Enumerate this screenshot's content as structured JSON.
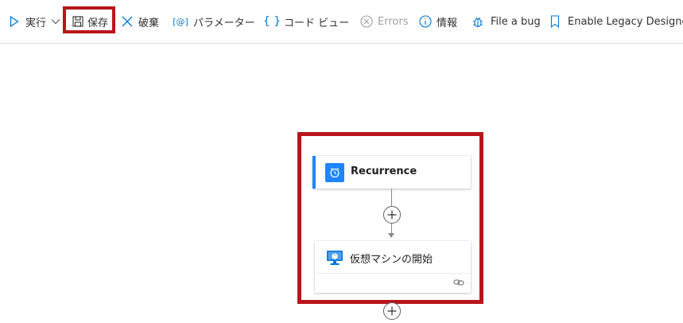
{
  "toolbar": {
    "run_label": "実行",
    "save_label": "保存",
    "discard_label": "破棄",
    "parameters_label": "パラメーター",
    "code_view_label": "コード ビュー",
    "errors_label": "Errors",
    "info_label": "情報",
    "file_bug_label": "File a bug",
    "legacy_label": "Enable Legacy Designer"
  },
  "flow": {
    "trigger": {
      "title": "Recurrence",
      "icon": "clock-icon"
    },
    "action": {
      "title": "仮想マシンの開始",
      "icon": "virtual-machine-icon"
    }
  },
  "colors": {
    "accent": "#0078d4",
    "highlight": "#b8161b",
    "trigger_blue": "#1f85ff"
  }
}
